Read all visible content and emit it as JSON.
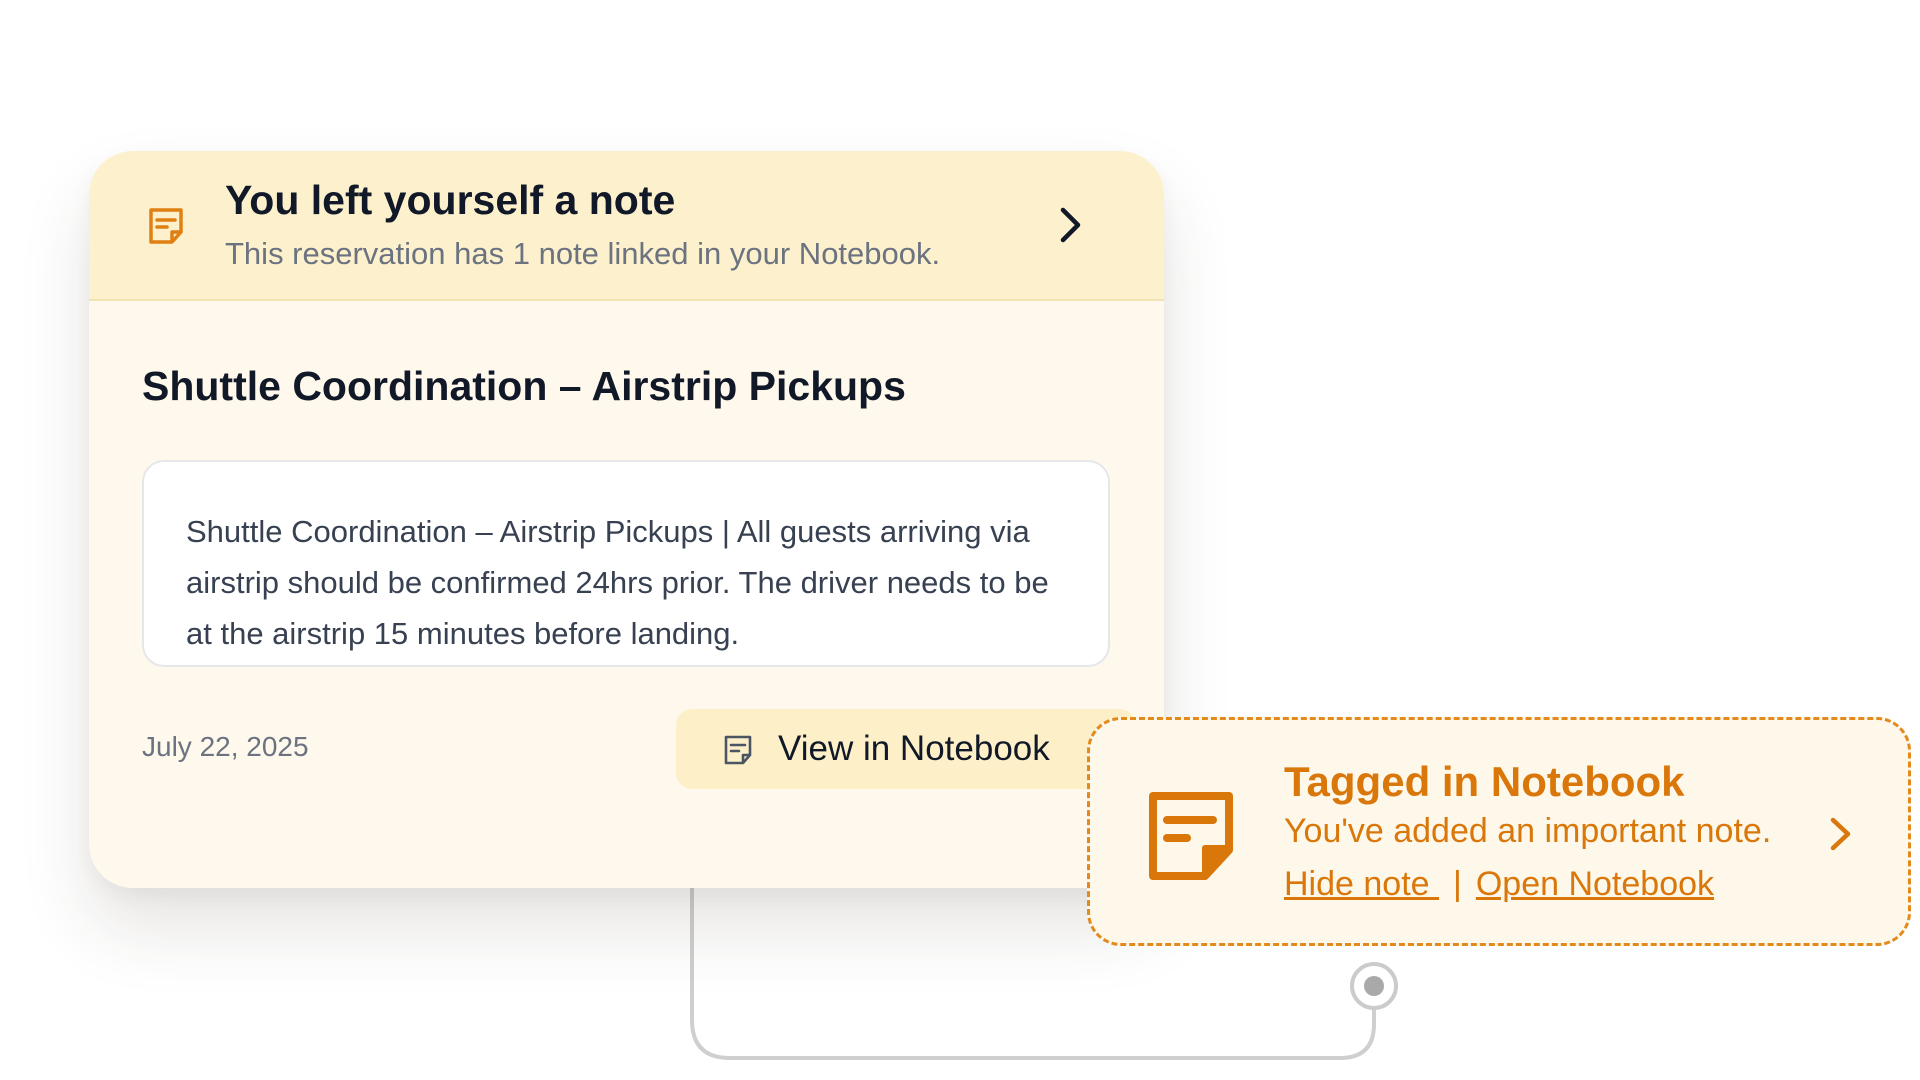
{
  "header": {
    "icon": "note-icon",
    "title": "You left yourself a note",
    "subtitle": "This reservation has 1 note linked in your Notebook.",
    "chevron_icon": "chevron-right-icon"
  },
  "note": {
    "title": "Shuttle Coordination – Airstrip Pickups",
    "body": "Shuttle Coordination – Airstrip Pickups | All guests arriving via airstrip should be confirmed 24hrs prior. The driver needs to be at the airstrip 15 minutes before landing.",
    "date": "July 22, 2025"
  },
  "view_button": {
    "icon": "note-icon",
    "label": "View in Notebook"
  },
  "tag_popover": {
    "icon": "note-icon",
    "title": "Tagged in Notebook",
    "subtitle": "You've added an important note.",
    "chevron_icon": "chevron-right-icon",
    "hide_link": "Hide note ",
    "separator": "|",
    "open_link": "Open Notebook"
  },
  "colors": {
    "header_bg": "#fdf1cd",
    "card_bg": "#fef9ec",
    "accent_orange": "#d9770a",
    "dashed_border": "#e38a1c",
    "title_text": "#111827",
    "muted_text": "#6b7280"
  }
}
